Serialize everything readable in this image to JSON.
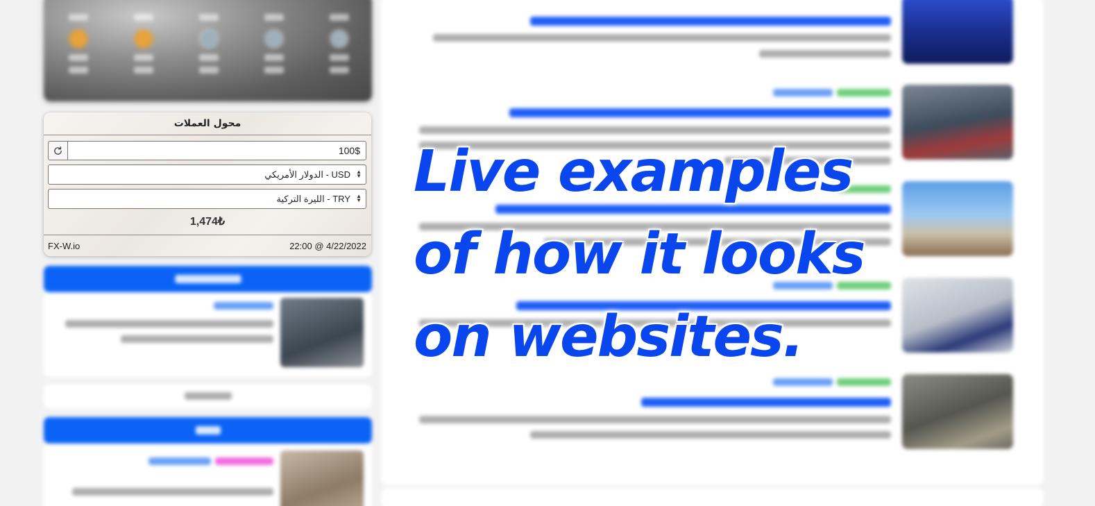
{
  "converter": {
    "title": "محول العملات",
    "amount": "100$",
    "from_currency": "USD - الدولار الأمريكي",
    "to_currency": "TRY - الليرة التركية",
    "result": "1,474₺",
    "brand": "FX-W.io",
    "timestamp": "22:00 @ 4/22/2022",
    "refresh_icon": "refresh-icon",
    "select_icon": "updown-arrows-icon"
  },
  "overlay": {
    "line1": "Live examples",
    "line2": "of how it looks",
    "line3": "on websites."
  },
  "colors": {
    "accent_blue": "#0a63f6",
    "overlay_blue": "#0a46ee",
    "page_bg": "#f2f2f3"
  }
}
